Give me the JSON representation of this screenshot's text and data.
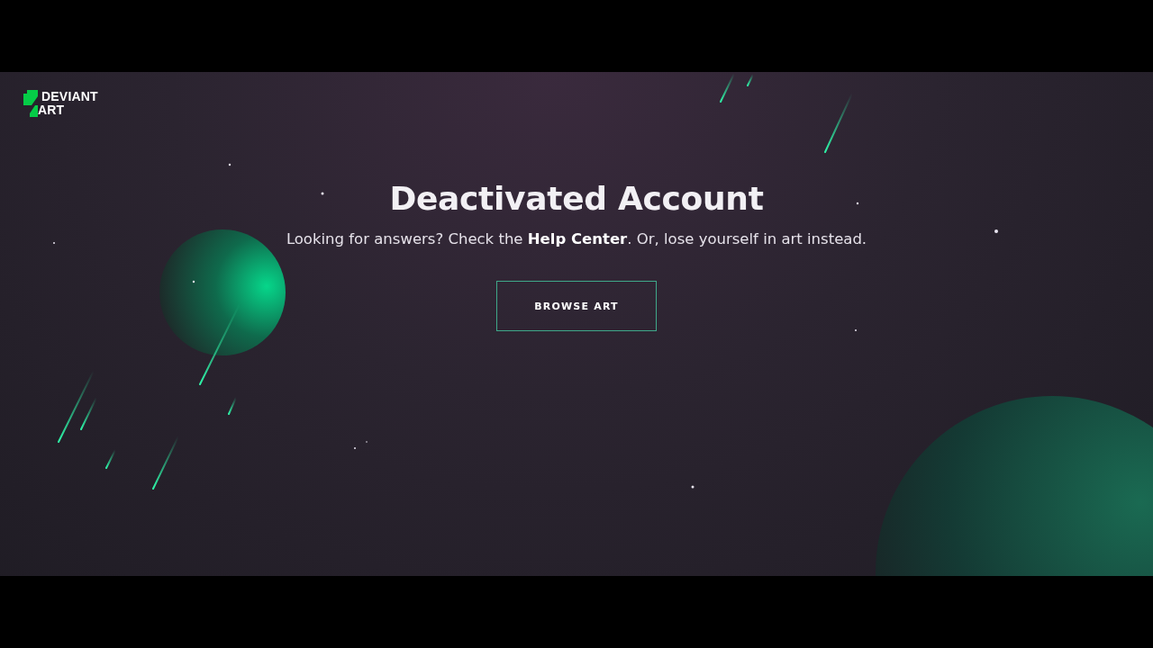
{
  "logo": {
    "lines": [
      "DEVIANT",
      "ART"
    ]
  },
  "heading": "Deactivated Account",
  "message": {
    "before": "Looking for answers? Check the ",
    "link": "Help Center",
    "after": ". Or, lose yourself in art instead."
  },
  "button": "BROWSE ART"
}
